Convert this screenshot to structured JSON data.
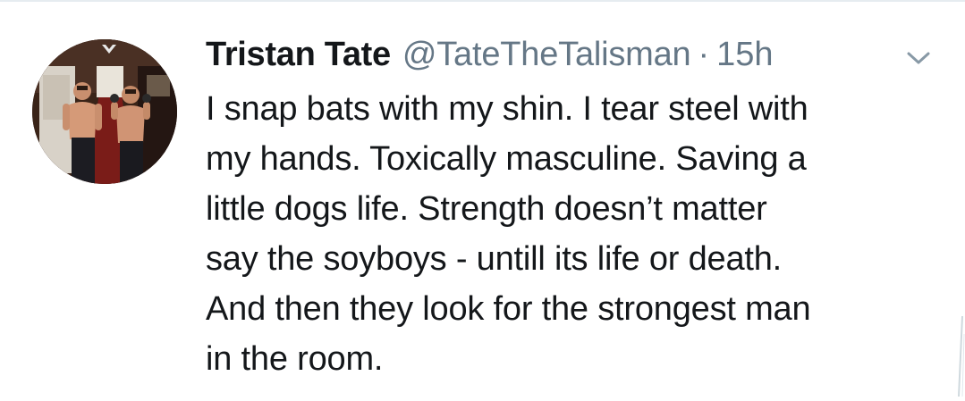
{
  "tweet": {
    "display_name": "Tristan Tate",
    "handle": "@TateTheTalisman",
    "separator": "·",
    "timestamp": "15h",
    "avatar_icon": "profile-avatar",
    "menu_icon": "chevron-down-icon",
    "text_lines": [
      "I snap bats with my shin. I tear steel with",
      "my hands. Toxically masculine. Saving a",
      "little dogs life. Strength doesn’t matter",
      "say the soyboys - untill its life or death.",
      "And then they look for the strongest man",
      "in the room."
    ]
  },
  "colors": {
    "primary_text": "#14171a",
    "secondary_text": "#657786",
    "divider": "#e6ecf0",
    "background": "#ffffff"
  }
}
